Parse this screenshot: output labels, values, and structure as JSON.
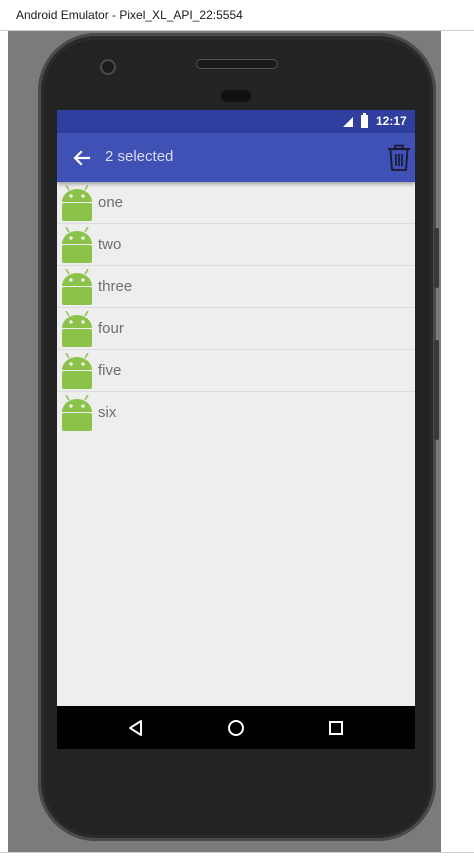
{
  "window": {
    "title": "Android Emulator - Pixel_XL_API_22:5554"
  },
  "status_bar": {
    "time": "12:17"
  },
  "app_bar": {
    "title": "2 selected"
  },
  "list": {
    "items": [
      {
        "label": "one"
      },
      {
        "label": "two"
      },
      {
        "label": "three"
      },
      {
        "label": "four"
      },
      {
        "label": "five"
      },
      {
        "label": "six"
      }
    ]
  },
  "nav_bar": {
    "buttons": [
      "back-triangle-icon",
      "home-circle-icon",
      "recents-square-icon"
    ]
  },
  "colors": {
    "status_bar": "#303f9f",
    "app_bar": "#3f51b5",
    "android": "#8bc34a"
  }
}
